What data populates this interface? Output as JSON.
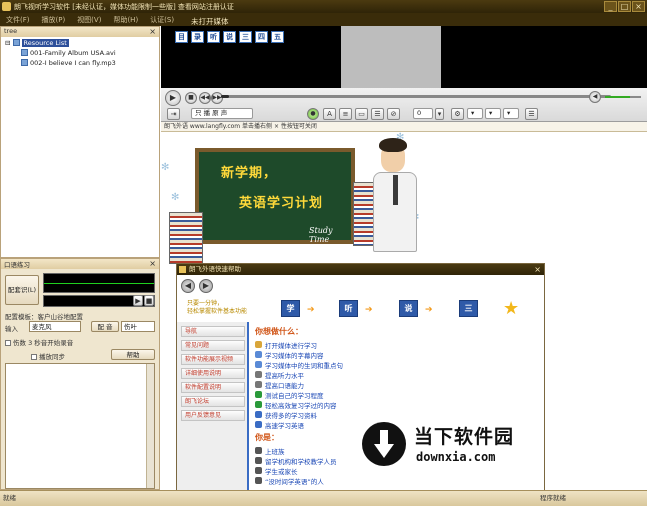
{
  "window": {
    "title": "朗飞视听学习软件 [未经认证，媒体功能限制一些版] 查看网站注册认证",
    "controls": [
      "_",
      "□",
      "×"
    ]
  },
  "menu": {
    "items": [
      "文件(F)",
      "播放(P)",
      "视图(V)",
      "帮助(H)",
      "认证(S)"
    ],
    "media_title": "未打开媒体"
  },
  "left_panel": {
    "header": "tree",
    "root_label": "Resource List",
    "files": [
      "001-Family Album USA.avi",
      "002-I believe I can fly.mp3"
    ]
  },
  "oral_practice": {
    "header": "口语练习",
    "record_button": "配套识(L)",
    "section_label": "配置模板：客户山谷地配置",
    "input_label": "输入",
    "input_value": "麦克风",
    "match_label": "配 音",
    "match_value": "伤叶",
    "check1_label": "伤数 3 秒音开始录音",
    "check2_label": "播放同步",
    "help_button": "帮助"
  },
  "player": {
    "video_buttons": [
      "目",
      "录",
      "听",
      "说",
      "三",
      "四",
      "五"
    ],
    "mode_select": "只 播 原 声",
    "progress": 0.02,
    "volume": 0.7,
    "speed_value": "0"
  },
  "info_bar": {
    "text": "朗飞外语  www.langfly.com  单击播右侧 × 性按钮可关闭"
  },
  "banner": {
    "line1": "新学期，",
    "line2": "英语学习计划",
    "subtitle": "Study Time"
  },
  "dialog": {
    "title": "朗飞外语快速帮助",
    "slogan": "只要一分钟，\n轻松掌握软件基本功能",
    "steps": [
      "学",
      "听",
      "说",
      "三"
    ],
    "side_items": [
      "导航",
      "常见问题",
      "软件功能展示视频",
      "详细使用说明",
      "软件配置说明",
      "朗飞论坛",
      "用户反馈意见"
    ],
    "question1": "你想做什么：",
    "actions": [
      "打开媒体进行学习",
      "学习媒体的字幕内容",
      "学习媒体中的生词和重点句",
      "提高听力水平",
      "提高口语能力",
      "测试自己的学习程度",
      "轻松高效复习学过的内容",
      "获得多的学习资料",
      "高速学习英语"
    ],
    "question2": "你是：",
    "roles": [
      "上班族",
      "留学机构和学校教学人员",
      "学生或家长",
      "“没时间学英语”的人"
    ]
  },
  "watermark": {
    "cn": "当下软件园",
    "en": "downxia.com"
  },
  "status": {
    "left": "就绪",
    "right": "程序就绪"
  }
}
